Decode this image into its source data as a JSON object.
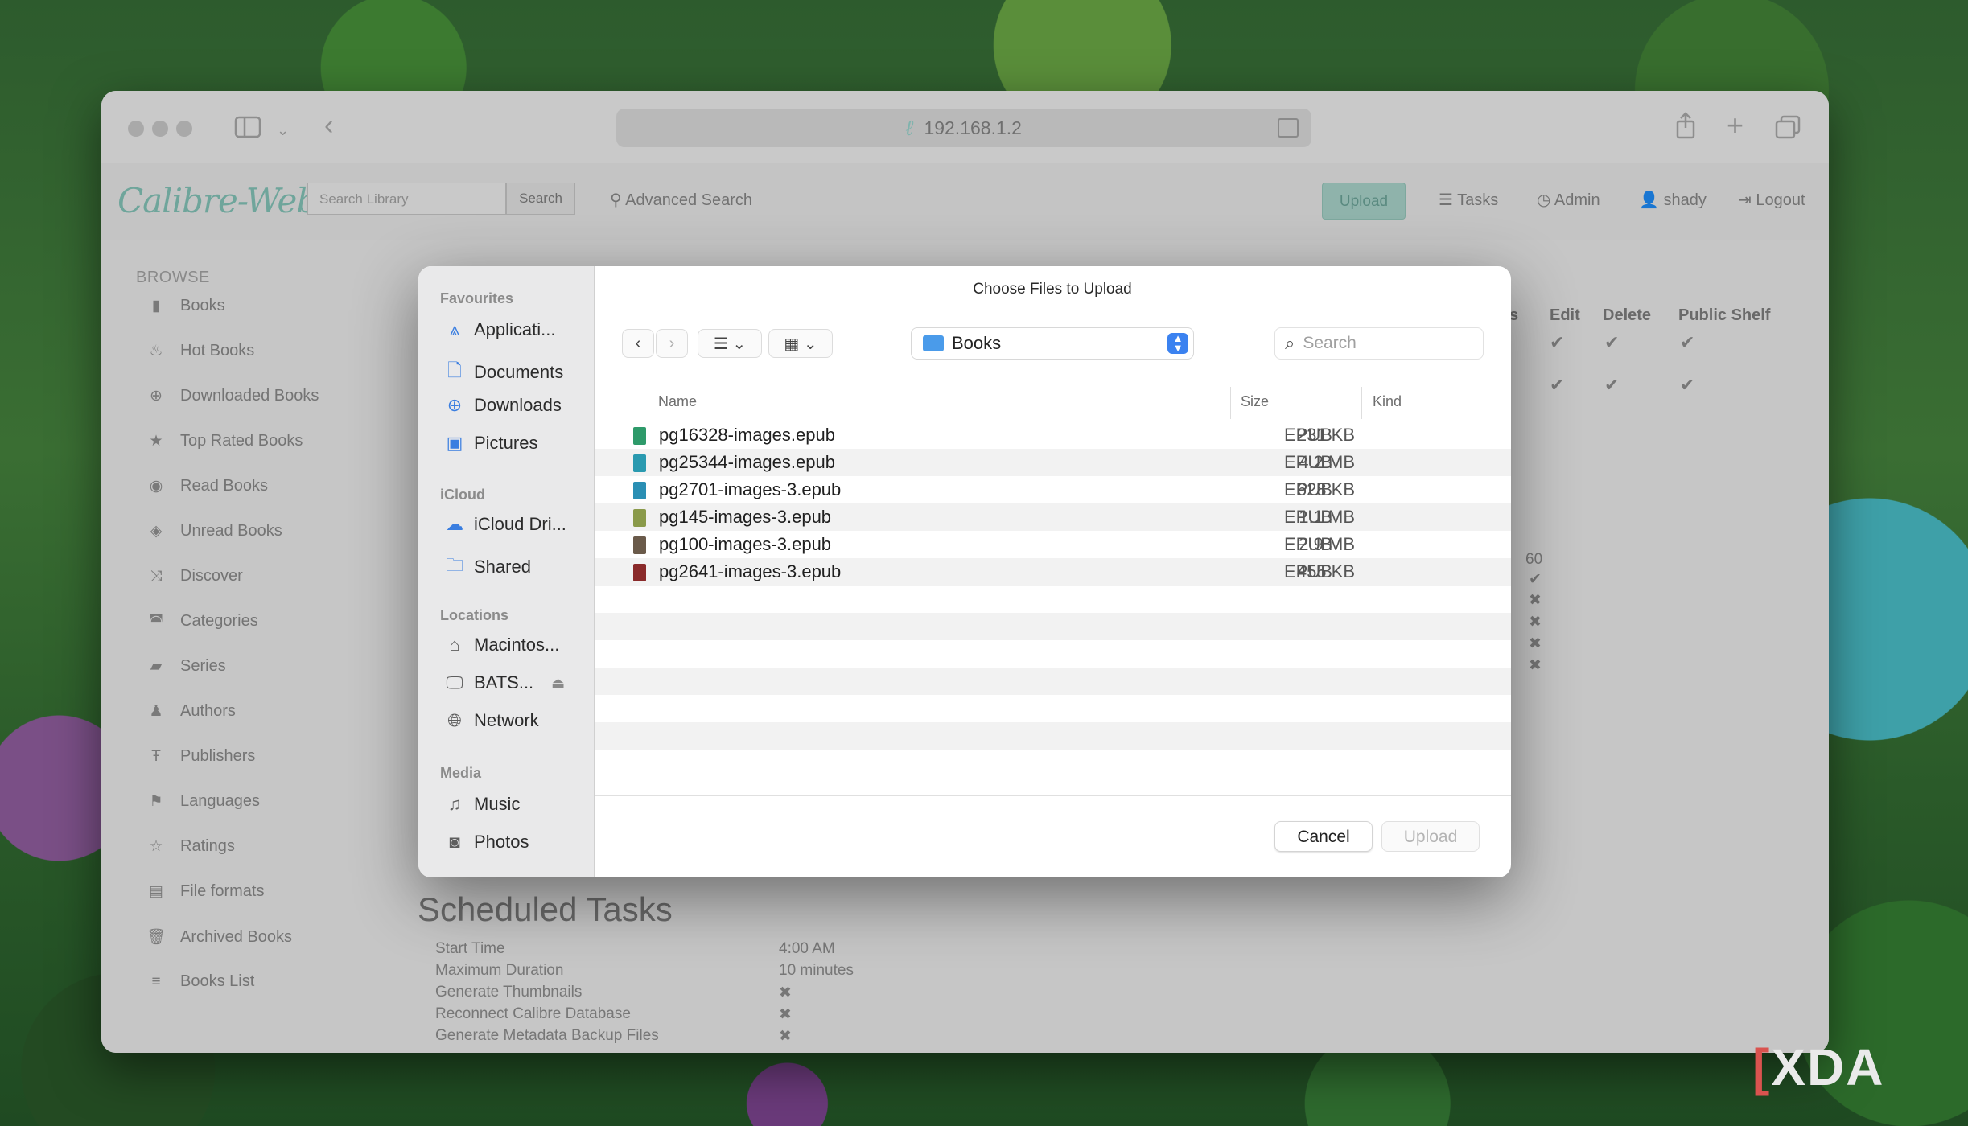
{
  "browser": {
    "url": "192.168.1.2"
  },
  "nav": {
    "logo": "Calibre-Web",
    "search_placeholder": "Search Library",
    "search_button": "Search",
    "advanced_search": "Advanced Search",
    "upload": "Upload",
    "tasks": "Tasks",
    "admin": "Admin",
    "user": "shady",
    "logout": "Logout"
  },
  "sidebar": {
    "heading": "BROWSE",
    "items": [
      {
        "label": "Books",
        "icon": "book-icon"
      },
      {
        "label": "Hot Books",
        "icon": "fire-icon"
      },
      {
        "label": "Downloaded Books",
        "icon": "download-icon"
      },
      {
        "label": "Top Rated Books",
        "icon": "star-icon"
      },
      {
        "label": "Read Books",
        "icon": "eye-icon"
      },
      {
        "label": "Unread Books",
        "icon": "eye-slash-icon"
      },
      {
        "label": "Discover",
        "icon": "shuffle-icon"
      },
      {
        "label": "Categories",
        "icon": "inbox-icon"
      },
      {
        "label": "Series",
        "icon": "bookmark-icon"
      },
      {
        "label": "Authors",
        "icon": "user-icon"
      },
      {
        "label": "Publishers",
        "icon": "text-icon"
      },
      {
        "label": "Languages",
        "icon": "flag-icon"
      },
      {
        "label": "Ratings",
        "icon": "star-outline-icon"
      },
      {
        "label": "File formats",
        "icon": "file-icon"
      },
      {
        "label": "Archived Books",
        "icon": "trash-icon"
      },
      {
        "label": "Books List",
        "icon": "list-icon"
      }
    ]
  },
  "user_table": {
    "headers": [
      "s",
      "Edit",
      "Delete",
      "Public Shelf"
    ]
  },
  "background_values": {
    "number": "60"
  },
  "scheduled": {
    "title": "Scheduled Tasks",
    "rows": [
      {
        "label": "Start Time",
        "value": "4:00 AM"
      },
      {
        "label": "Maximum Duration",
        "value": "10 minutes"
      },
      {
        "label": "Generate Thumbnails",
        "value": "✖"
      },
      {
        "label": "Reconnect Calibre Database",
        "value": "✖"
      },
      {
        "label": "Generate Metadata Backup Files",
        "value": "✖"
      }
    ]
  },
  "dialog": {
    "title": "Choose Files to Upload",
    "location": "Books",
    "search_placeholder": "Search",
    "sections": {
      "favourites": "Favourites",
      "icloud": "iCloud",
      "locations": "Locations",
      "media": "Media"
    },
    "favourites": [
      "Applicati...",
      "Documents",
      "Downloads",
      "Pictures"
    ],
    "icloud": [
      "iCloud Dri...",
      "Shared"
    ],
    "locations": [
      "Macintos...",
      "BATS...",
      "Network"
    ],
    "media": [
      "Music",
      "Photos"
    ],
    "columns": {
      "name": "Name",
      "size": "Size",
      "kind": "Kind"
    },
    "files": [
      {
        "name": "pg16328-images.epub",
        "size": "231 KB",
        "kind": "EPUB",
        "color": "#2e9a6a"
      },
      {
        "name": "pg25344-images.epub",
        "size": "4.2 MB",
        "kind": "EPUB",
        "color": "#2a9ab0"
      },
      {
        "name": "pg2701-images-3.epub",
        "size": "628 KB",
        "kind": "EPUB",
        "color": "#2a8fb4"
      },
      {
        "name": "pg145-images-3.epub",
        "size": "1.1 MB",
        "kind": "EPUB",
        "color": "#8a9a4a"
      },
      {
        "name": "pg100-images-3.epub",
        "size": "2.9 MB",
        "kind": "EPUB",
        "color": "#6a5a4a"
      },
      {
        "name": "pg2641-images-3.epub",
        "size": "455 KB",
        "kind": "EPUB",
        "color": "#8a2a2a"
      }
    ],
    "cancel": "Cancel",
    "upload": "Upload"
  },
  "watermark": "XDA"
}
